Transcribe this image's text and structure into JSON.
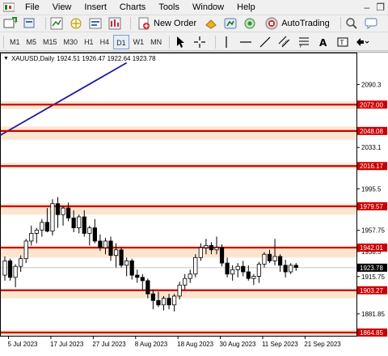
{
  "menu": {
    "items": [
      "File",
      "View",
      "Insert",
      "Charts",
      "Tools",
      "Window",
      "Help"
    ],
    "window_controls": [
      "–",
      "❐"
    ]
  },
  "toolbar": {
    "new_order_label": "New Order",
    "autotrading_label": "AutoTrading"
  },
  "timeframes": [
    "M1",
    "M5",
    "M15",
    "M30",
    "H1",
    "H4",
    "D1",
    "W1",
    "MN"
  ],
  "active_timeframe": "D1",
  "chart_info": {
    "symbol_period": "XAUUSD,Daily",
    "ohlc": "1924.51 1926.47 1922.64 1923.78"
  },
  "colors": {
    "bull": "#ffffff",
    "bear": "#000000",
    "level_line": "#cc0000",
    "zone_fill": "#fce5cf",
    "trend_line": "#1a1aa0",
    "current_label": "#000000"
  },
  "chart_data": {
    "type": "candlestick",
    "symbol": "XAUUSD",
    "period": "Daily",
    "ylim": [
      1864.85,
      2109.0
    ],
    "y_ticks": [
      2090.3,
      2033.1,
      1995.5,
      1957.75,
      1938.5,
      1915.75,
      1881.85
    ],
    "x_labels": [
      "5 Jul 2023",
      "17 Jul 2023",
      "27 Jul 2023",
      "8 Aug 2023",
      "18 Aug 2023",
      "30 Aug 2023",
      "11 Sep 2023",
      "21 Sep 2023"
    ],
    "x_label_index": [
      1,
      9,
      17,
      25,
      33,
      41,
      49,
      57
    ],
    "levels": [
      {
        "value": 2072.0,
        "label": "2072.00",
        "zone": [
          2068,
          2075
        ]
      },
      {
        "value": 2048.08,
        "label": "2048.08",
        "zone": [
          2040,
          2052
        ]
      },
      {
        "value": 2016.17,
        "label": "2016.17",
        "zone": [
          2014,
          2019
        ]
      },
      {
        "value": 1979.57,
        "label": "1979.57",
        "zone": [
          1972,
          1982
        ]
      },
      {
        "value": 1942.01,
        "label": "1942.01",
        "zone": [
          1933,
          1944
        ]
      },
      {
        "value": 1903.27,
        "label": "1903.27",
        "zone": [
          1896,
          1904
        ]
      },
      {
        "value": 1864.85,
        "label": "1864.85",
        "zone": [
          1862,
          1867
        ]
      }
    ],
    "current_price": {
      "value": 1923.78,
      "label": "1923.78"
    },
    "trend_line": {
      "x1": 0,
      "y1": 2044,
      "x2": 23,
      "y2": 2110
    },
    "candles": [
      [
        1917,
        1934,
        1912,
        1930
      ],
      [
        1930,
        1932,
        1912,
        1915
      ],
      [
        1915,
        1927,
        1906,
        1925
      ],
      [
        1925,
        1935,
        1920,
        1932
      ],
      [
        1932,
        1950,
        1928,
        1948
      ],
      [
        1948,
        1962,
        1944,
        1955
      ],
      [
        1955,
        1960,
        1946,
        1958
      ],
      [
        1958,
        1968,
        1952,
        1965
      ],
      [
        1965,
        1978,
        1956,
        1957
      ],
      [
        1957,
        1986,
        1953,
        1982
      ],
      [
        1982,
        1988,
        1960,
        1972
      ],
      [
        1972,
        1980,
        1962,
        1978
      ],
      [
        1978,
        1983,
        1966,
        1969
      ],
      [
        1969,
        1976,
        1956,
        1960
      ],
      [
        1960,
        1972,
        1955,
        1970
      ],
      [
        1970,
        1976,
        1952,
        1955
      ],
      [
        1955,
        1962,
        1944,
        1960
      ],
      [
        1960,
        1968,
        1946,
        1948
      ],
      [
        1948,
        1954,
        1939,
        1942
      ],
      [
        1942,
        1951,
        1936,
        1948
      ],
      [
        1948,
        1952,
        1930,
        1935
      ],
      [
        1935,
        1946,
        1924,
        1940
      ],
      [
        1940,
        1942,
        1924,
        1926
      ],
      [
        1926,
        1933,
        1916,
        1930
      ],
      [
        1930,
        1932,
        1913,
        1917
      ],
      [
        1917,
        1922,
        1910,
        1915
      ],
      [
        1915,
        1918,
        1904,
        1912
      ],
      [
        1912,
        1914,
        1896,
        1900
      ],
      [
        1900,
        1904,
        1886,
        1894
      ],
      [
        1894,
        1902,
        1888,
        1890
      ],
      [
        1890,
        1898,
        1885,
        1896
      ],
      [
        1896,
        1900,
        1886,
        1890
      ],
      [
        1890,
        1900,
        1884,
        1898
      ],
      [
        1898,
        1911,
        1895,
        1908
      ],
      [
        1908,
        1918,
        1904,
        1914
      ],
      [
        1914,
        1922,
        1910,
        1918
      ],
      [
        1918,
        1936,
        1915,
        1933
      ],
      [
        1933,
        1946,
        1930,
        1942
      ],
      [
        1942,
        1950,
        1936,
        1944
      ],
      [
        1944,
        1947,
        1936,
        1940
      ],
      [
        1940,
        1952,
        1936,
        1942
      ],
      [
        1942,
        1945,
        1925,
        1928
      ],
      [
        1928,
        1933,
        1915,
        1918
      ],
      [
        1918,
        1926,
        1912,
        1922
      ],
      [
        1922,
        1928,
        1915,
        1925
      ],
      [
        1925,
        1930,
        1916,
        1920
      ],
      [
        1920,
        1926,
        1912,
        1914
      ],
      [
        1914,
        1918,
        1908,
        1916
      ],
      [
        1916,
        1929,
        1910,
        1927
      ],
      [
        1927,
        1938,
        1924,
        1936
      ],
      [
        1936,
        1940,
        1928,
        1930
      ],
      [
        1930,
        1950,
        1926,
        1934
      ],
      [
        1934,
        1936,
        1920,
        1926
      ],
      [
        1926,
        1931,
        1915,
        1920
      ],
      [
        1920,
        1928,
        1918,
        1926
      ],
      [
        1926,
        1928,
        1921,
        1924
      ]
    ]
  }
}
